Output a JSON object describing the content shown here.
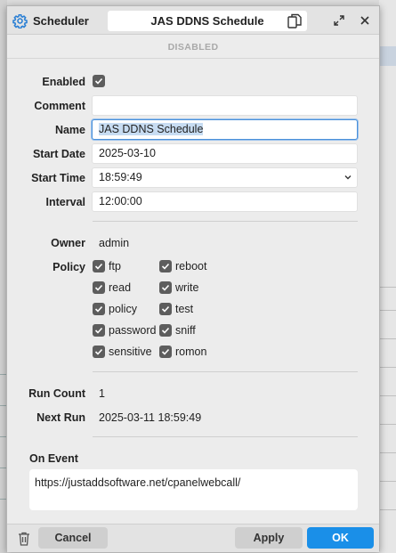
{
  "window": {
    "app_name": "Scheduler",
    "title": "JAS DDNS Schedule",
    "status": "DISABLED"
  },
  "form": {
    "enabled_label": "Enabled",
    "enabled": true,
    "comment_label": "Comment",
    "comment_value": "",
    "name_label": "Name",
    "name_value": "JAS DDNS Schedule",
    "start_date_label": "Start Date",
    "start_date_value": "2025-03-10",
    "start_time_label": "Start Time",
    "start_time_value": "18:59:49",
    "interval_label": "Interval",
    "interval_value": "12:00:00",
    "owner_label": "Owner",
    "owner_value": "admin",
    "policy_label": "Policy",
    "policies": [
      {
        "label": "ftp",
        "checked": true
      },
      {
        "label": "reboot",
        "checked": true
      },
      {
        "label": "read",
        "checked": true
      },
      {
        "label": "write",
        "checked": true
      },
      {
        "label": "policy",
        "checked": true
      },
      {
        "label": "test",
        "checked": true
      },
      {
        "label": "password",
        "checked": true
      },
      {
        "label": "sniff",
        "checked": true
      },
      {
        "label": "sensitive",
        "checked": true
      },
      {
        "label": "romon",
        "checked": true
      }
    ],
    "run_count_label": "Run Count",
    "run_count_value": "1",
    "next_run_label": "Next Run",
    "next_run_value": "2025-03-11 18:59:49",
    "on_event_label": "On Event",
    "on_event_line1": "https://justaddsoftware.net/cpanelwebcall/"
  },
  "footer": {
    "cancel_label": "Cancel",
    "apply_label": "Apply",
    "ok_label": "OK"
  },
  "icons": {
    "app": "gear-icon",
    "copy": "copy-icon",
    "expand": "expand-icon",
    "close": "close-icon",
    "delete": "trash-icon",
    "dropdown": "chevron-down-icon",
    "checkbox": "check-icon"
  },
  "colors": {
    "accent": "#1a8fe8",
    "checkbox": "#5d5d5d",
    "focus": "#4a90d9"
  }
}
